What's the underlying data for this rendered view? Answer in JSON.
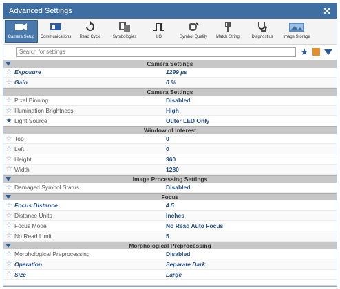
{
  "window": {
    "title": "Advanced Settings",
    "close_label": "✕"
  },
  "toolbar": {
    "items": [
      {
        "label": "Camera Setup",
        "icon": "camera-icon",
        "active": true
      },
      {
        "label": "Communications",
        "icon": "communications-icon"
      },
      {
        "label": "Read Cycle",
        "icon": "read-cycle-icon"
      },
      {
        "label": "Symbologies",
        "icon": "symbologies-icon"
      },
      {
        "label": "I/O",
        "icon": "io-icon"
      },
      {
        "label": "Symbol Quality",
        "icon": "symbol-quality-icon"
      },
      {
        "label": "Match String",
        "icon": "match-string-icon"
      },
      {
        "label": "Diagnostics",
        "icon": "diagnostics-icon"
      },
      {
        "label": "Image Storage",
        "icon": "image-storage-icon"
      }
    ]
  },
  "search": {
    "placeholder": "Search for settings"
  },
  "colors": {
    "accent": "#3f6ea3",
    "value_blue": "#27518a",
    "orange": "#e58e2a"
  },
  "sections": [
    {
      "title": "Camera Settings",
      "rows": [
        {
          "name": "Exposure",
          "value": "1299 µs",
          "emphasis": true
        },
        {
          "name": "Gain",
          "value": "0 %",
          "emphasis": true
        }
      ]
    },
    {
      "title": "Camera Settings",
      "rows": [
        {
          "name": "Pixel Binning",
          "value": "Disabled"
        },
        {
          "name": "Illumination Brightness",
          "value": "High"
        },
        {
          "name": "Light Source",
          "value": "Outer LED Only",
          "starred": true
        }
      ]
    },
    {
      "title": "Window of Interest",
      "rows": [
        {
          "name": "Top",
          "value": "0"
        },
        {
          "name": "Left",
          "value": "0"
        },
        {
          "name": "Height",
          "value": "960"
        },
        {
          "name": "Width",
          "value": "1280"
        }
      ]
    },
    {
      "title": "Image Processing Settings",
      "rows": [
        {
          "name": "Damaged Symbol Status",
          "value": "Disabled"
        }
      ]
    },
    {
      "title": "Focus",
      "rows": [
        {
          "name": "Focus Distance",
          "value": "4.5",
          "emphasis": true
        },
        {
          "name": "Distance Units",
          "value": "Inches"
        },
        {
          "name": "Focus Mode",
          "value": "No Read Auto Focus"
        },
        {
          "name": "No Read Limit",
          "value": "5"
        }
      ]
    },
    {
      "title": "Morphological Preprocessing",
      "rows": [
        {
          "name": "Morphological Preprocessing",
          "value": "Disabled"
        },
        {
          "name": "Operation",
          "value": "Separate Dark",
          "emphasis": true
        },
        {
          "name": "Size",
          "value": "Large",
          "emphasis": true
        }
      ]
    }
  ]
}
